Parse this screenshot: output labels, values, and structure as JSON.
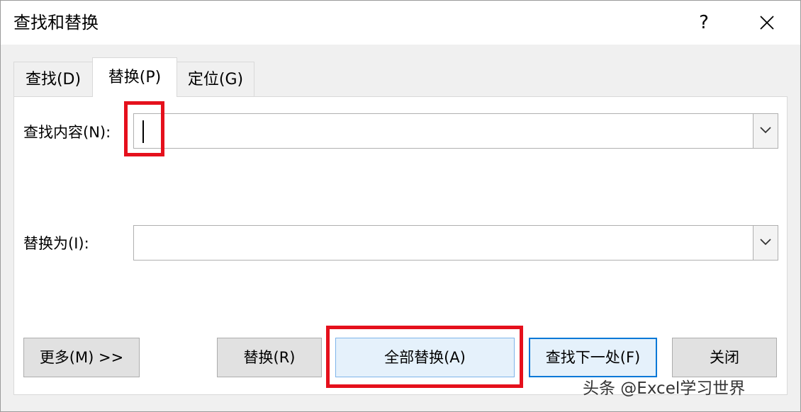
{
  "dialog": {
    "title": "查找和替换",
    "help_label": "?"
  },
  "tabs": [
    {
      "label": "查找(D)"
    },
    {
      "label": "替换(P)"
    },
    {
      "label": "定位(G)"
    }
  ],
  "find": {
    "label": "查找内容(N):",
    "value": ""
  },
  "replace": {
    "label": "替换为(I):",
    "value": ""
  },
  "buttons": {
    "more": "更多(M) >>",
    "replace": "替换(R)",
    "replace_all": "全部替换(A)",
    "find_next": "查找下一处(F)",
    "close": "关闭"
  },
  "watermark": "头条 @Excel学习世界",
  "colors": {
    "highlight": "#e5101c",
    "focus": "#0078d7"
  }
}
